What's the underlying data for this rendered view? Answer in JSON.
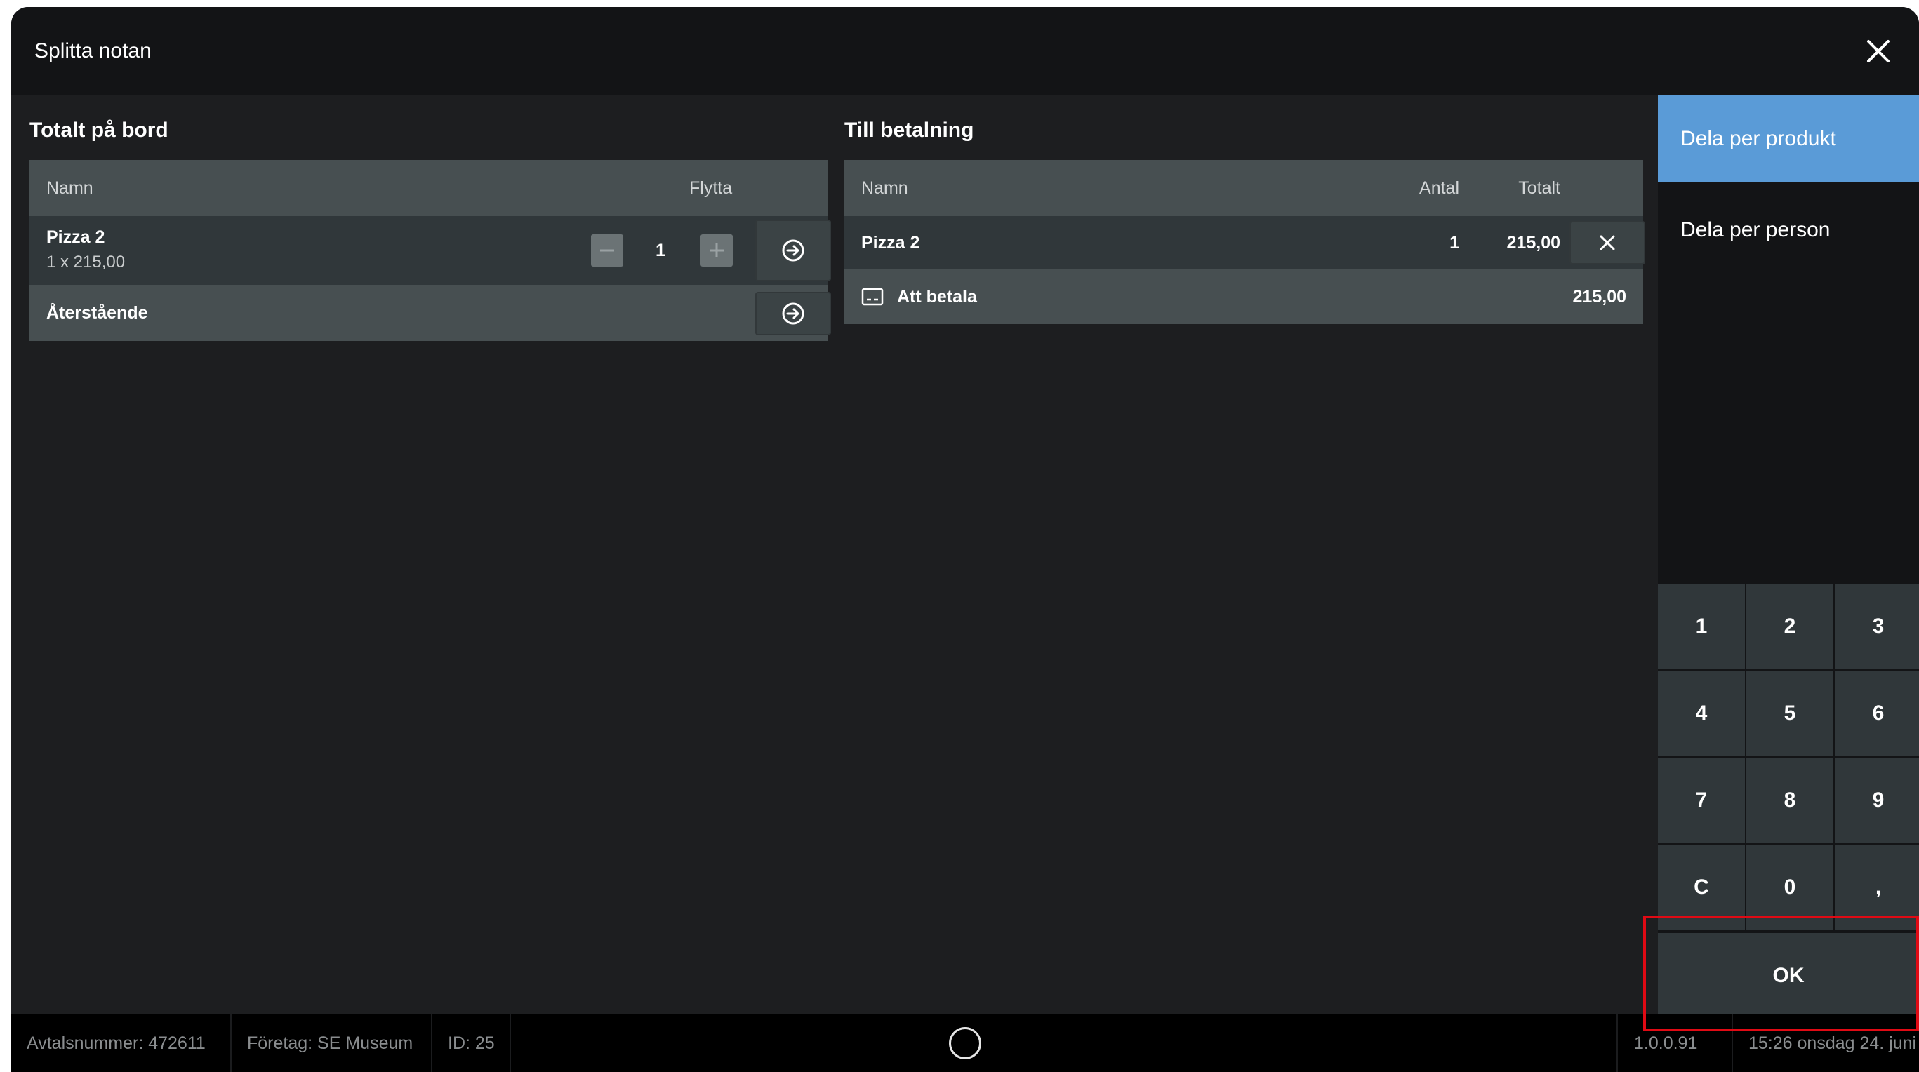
{
  "window": {
    "title": "Splitta notan"
  },
  "left": {
    "title": "Totalt på bord",
    "headers": {
      "name": "Namn",
      "move": "Flytta"
    },
    "item": {
      "name": "Pizza 2",
      "detail": "1 x 215,00",
      "qty": "1"
    },
    "remaining": "Återstående"
  },
  "middle": {
    "title": "Till betalning",
    "headers": {
      "name": "Namn",
      "qty": "Antal",
      "total": "Totalt"
    },
    "item": {
      "name": "Pizza 2",
      "qty": "1",
      "total": "215,00"
    },
    "due": {
      "label": "Att betala",
      "value": "215,00"
    }
  },
  "modes": {
    "product": "Dela per produkt",
    "person": "Dela per person"
  },
  "keypad": {
    "k1": "1",
    "k2": "2",
    "k3": "3",
    "k4": "4",
    "k5": "5",
    "k6": "6",
    "k7": "7",
    "k8": "8",
    "k9": "9",
    "clear": "C",
    "k0": "0",
    "comma": ",",
    "ok": "OK"
  },
  "status": {
    "agreement": "Avtalsnummer: 472611",
    "company": "Företag: SE Museum",
    "id": "ID: 25",
    "version": "1.0.0.91",
    "datetime": "15:26 onsdag 24. juni"
  },
  "colors": {
    "accent": "#5a9bd7",
    "highlight": "#e00a14",
    "panel": "#474f51"
  }
}
